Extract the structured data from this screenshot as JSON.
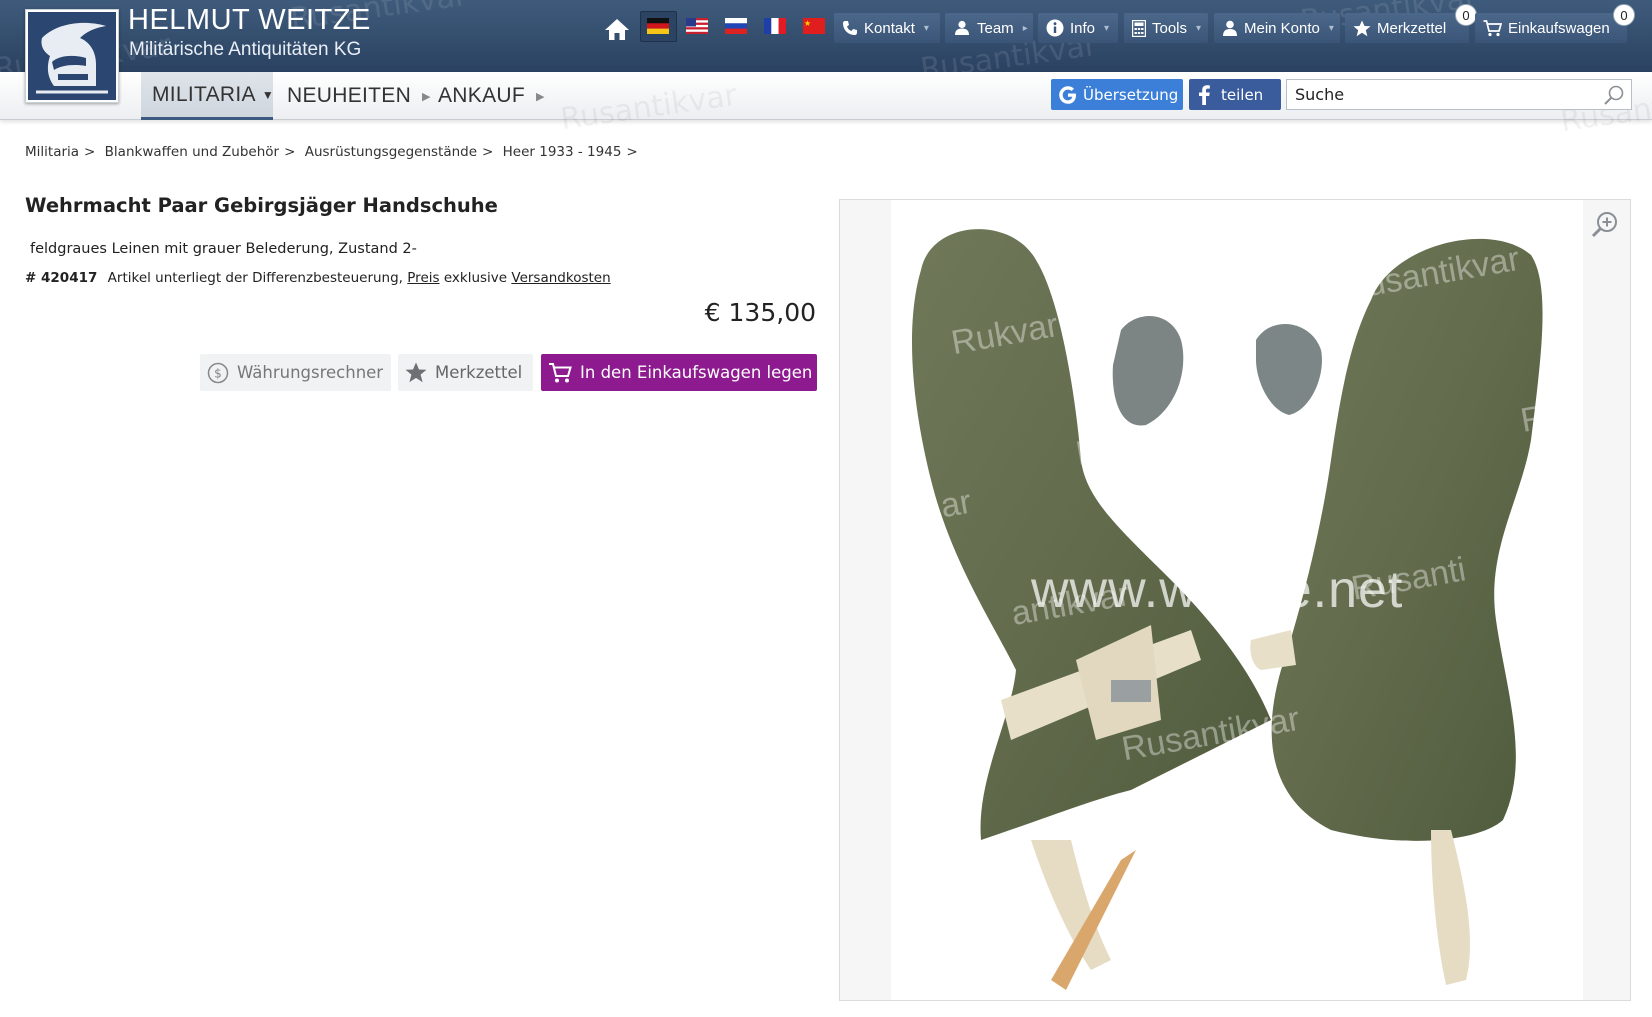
{
  "brand": {
    "title": "HELMUT WEITZE",
    "subtitle": "Militärische Antiquitäten KG",
    "watermark": "Rusantikvar"
  },
  "topnav": {
    "home_icon": "home-icon",
    "flags": [
      "de",
      "us",
      "ru",
      "fr",
      "cn"
    ],
    "items": [
      {
        "label": "Kontakt",
        "icon": "phone-icon"
      },
      {
        "label": "Team",
        "icon": "team-icon"
      },
      {
        "label": "Info",
        "icon": "info-icon"
      },
      {
        "label": "Tools",
        "icon": "calculator-icon"
      },
      {
        "label": "Mein Konto",
        "icon": "user-icon"
      },
      {
        "label": "Merkzettel",
        "icon": "star-icon",
        "badge": "0"
      },
      {
        "label": "Einkaufswagen",
        "icon": "cart-icon",
        "badge": "0"
      }
    ]
  },
  "menu": {
    "items": [
      {
        "label": "MILITARIA"
      },
      {
        "label": "NEUHEITEN"
      },
      {
        "label": "ANKAUF"
      }
    ],
    "translate_label": "Übersetzung",
    "share_label": "teilen",
    "search_placeholder": "Suche"
  },
  "breadcrumb": [
    "Militaria",
    "Blankwaffen und Zubehör",
    "Ausrüstungsgegenstände",
    "Heer 1933 - 1945"
  ],
  "product": {
    "title": "Wehrmacht Paar Gebirgsjäger Handschuhe",
    "description": "feldgraues Leinen mit grauer Belederung, Zustand 2-",
    "article_number": "# 420417",
    "tax_note": "Artikel unterliegt der Differenzbesteuerung,",
    "price_link": "Preis",
    "exclusive": "exklusive",
    "shipping_link": "Versandkosten",
    "price": "€ 135,00"
  },
  "actions": {
    "currency_label": "Währungsrechner",
    "wishlist_label": "Merkzettel",
    "cart_label": "In den Einkaufswagen legen"
  },
  "image": {
    "site_watermark": "www.weitze.net",
    "watermark": "Rusantikvar",
    "watermark_partials": [
      "Rukvar",
      "Rus",
      "antikvar",
      "ar",
      "Rusanti",
      "Rusantikvar",
      "Rusantikvar",
      "R"
    ],
    "zoom_icon": "zoom-in-icon"
  },
  "colors": {
    "header": "#33506f",
    "cart_button": "#8e1a8f",
    "translate_button": "#3c7fd9",
    "share_button": "#3a5b9c",
    "glove": "#66704f"
  }
}
